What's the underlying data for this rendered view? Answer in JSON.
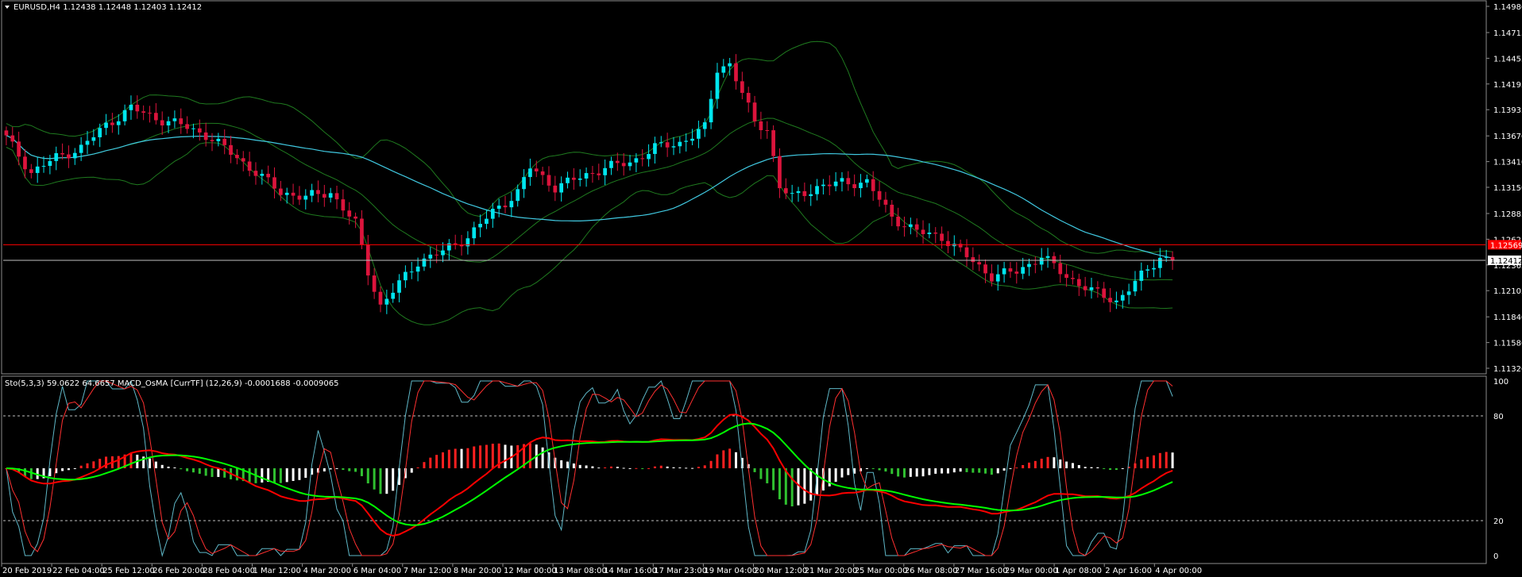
{
  "symbol_header": "EURUSD,H4  1.12438 1.12448 1.12403 1.12412",
  "osc_header": "Sto(5,3,3) 59.0622 64.6657  MACD_OsMA [CurrTF] (12,26,9) -0.0001688 -0.0009065",
  "price_axis": [
    "1.14980",
    "1.14715",
    "1.14455",
    "1.14195",
    "1.13935",
    "1.13670",
    "1.13410",
    "1.13150",
    "1.12885",
    "1.12625",
    "1.12365",
    "1.12105",
    "1.11840",
    "1.11580",
    "1.11320"
  ],
  "osc_axis": [
    "100",
    "80",
    "20",
    "0"
  ],
  "current_price_label": "1.12412",
  "red_level_label": "1.12569",
  "time_axis": [
    "20 Feb 2019",
    "22 Feb 04:00",
    "25 Feb 12:00",
    "26 Feb 20:00",
    "28 Feb 04:00",
    "1 Mar 12:00",
    "4 Mar 20:00",
    "6 Mar 04:00",
    "7 Mar 12:00",
    "8 Mar 20:00",
    "12 Mar 00:00",
    "13 Mar 08:00",
    "14 Mar 16:00",
    "17 Mar 23:00",
    "19 Mar 04:00",
    "20 Mar 12:00",
    "21 Mar 20:00",
    "25 Mar 00:00",
    "26 Mar 08:00",
    "27 Mar 16:00",
    "29 Mar 00:00",
    "1 Apr 08:00",
    "2 Apr 16:00",
    "4 Apr 00:00"
  ],
  "colors": {
    "bull": "#00e5ee",
    "bear": "#dc143c",
    "ma": "#40c8e0",
    "bands": "#1f7a1f",
    "red_line": "#ff0000",
    "white_line": "#c0c0c0",
    "sto_main": "#5fb8c8",
    "sto_signal": "#ff3030",
    "macd_main": "#ff0000",
    "macd_signal": "#00ff00",
    "hist_up": "#ff2020",
    "hist_down": "#30c030",
    "hist_fade": "#ffffff"
  },
  "chart_data": {
    "type": "candlestick",
    "symbol": "EURUSD",
    "timeframe": "H4",
    "last_bar": {
      "open": 1.12438,
      "high": 1.12448,
      "low": 1.12403,
      "close": 1.12412
    },
    "ylim": [
      1.1132,
      1.1498
    ],
    "red_level": 1.12569,
    "current_price": 1.12412,
    "close_path": [
      [
        0,
        1.1365
      ],
      [
        4,
        1.133
      ],
      [
        8,
        1.1345
      ],
      [
        12,
        1.1355
      ],
      [
        16,
        1.1378
      ],
      [
        20,
        1.1395
      ],
      [
        24,
        1.1385
      ],
      [
        28,
        1.1378
      ],
      [
        32,
        1.1368
      ],
      [
        36,
        1.135
      ],
      [
        40,
        1.133
      ],
      [
        44,
        1.131
      ],
      [
        48,
        1.1305
      ],
      [
        52,
        1.131
      ],
      [
        56,
        1.1278
      ],
      [
        58,
        1.123
      ],
      [
        60,
        1.1195
      ],
      [
        62,
        1.121
      ],
      [
        66,
        1.124
      ],
      [
        70,
        1.125
      ],
      [
        74,
        1.1265
      ],
      [
        78,
        1.129
      ],
      [
        82,
        1.131
      ],
      [
        84,
        1.1335
      ],
      [
        88,
        1.1315
      ],
      [
        92,
        1.1325
      ],
      [
        96,
        1.1335
      ],
      [
        100,
        1.134
      ],
      [
        104,
        1.1355
      ],
      [
        108,
        1.136
      ],
      [
        112,
        1.1375
      ],
      [
        114,
        1.1435
      ],
      [
        116,
        1.144
      ],
      [
        118,
        1.141
      ],
      [
        120,
        1.138
      ],
      [
        122,
        1.1375
      ],
      [
        124,
        1.1315
      ],
      [
        126,
        1.1305
      ],
      [
        130,
        1.1315
      ],
      [
        134,
        1.132
      ],
      [
        138,
        1.132
      ],
      [
        142,
        1.1285
      ],
      [
        146,
        1.127
      ],
      [
        150,
        1.1265
      ],
      [
        154,
        1.1245
      ],
      [
        158,
        1.1225
      ],
      [
        162,
        1.123
      ],
      [
        166,
        1.1245
      ],
      [
        170,
        1.1225
      ],
      [
        174,
        1.121
      ],
      [
        178,
        1.12
      ],
      [
        182,
        1.1225
      ],
      [
        185,
        1.1245
      ],
      [
        187,
        1.1241
      ]
    ],
    "oscillators": {
      "stochastic": {
        "params": "5,3,3",
        "main": 59.0622,
        "signal": 64.6657,
        "levels": [
          20,
          80
        ]
      },
      "macd_osma": {
        "params": "12,26,9",
        "main": -0.0001688,
        "signal": -0.0009065
      }
    }
  }
}
